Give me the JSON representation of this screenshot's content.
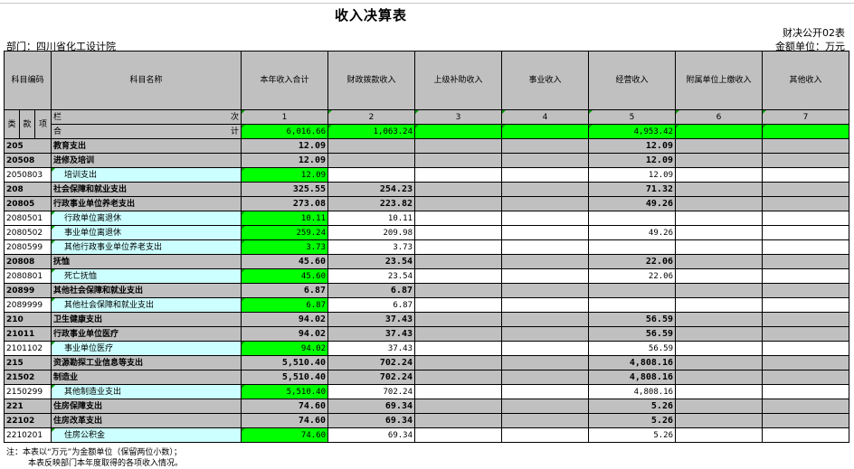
{
  "title": "收入决算表",
  "code_note": "财决公开02表",
  "unit_note": "金额单位：万元",
  "department": "部门：四川省化工设计院",
  "headers": {
    "code": "科目编码",
    "name": "科目名称",
    "cols": [
      "本年收入合计",
      "财政拨款收入",
      "上级补助收入",
      "事业收入",
      "经营收入",
      "附属单位上缴收入",
      "其他收入"
    ],
    "lei": "类",
    "kuan": "款",
    "xiang": "项",
    "lan": "栏",
    "ci": "次",
    "he": "合",
    "ji": "计",
    "colnums": [
      "1",
      "2",
      "3",
      "4",
      "5",
      "6",
      "7"
    ],
    "total": [
      "6,016.66",
      "1,063.24",
      "",
      "",
      "4,953.42",
      "",
      ""
    ]
  },
  "rows": [
    {
      "code": "205",
      "name": "教育支出",
      "vals": [
        "12.09",
        "",
        "",
        "",
        "12.09",
        "",
        ""
      ]
    },
    {
      "code": "20508",
      "name": "进修及培训",
      "vals": [
        "12.09",
        "",
        "",
        "",
        "12.09",
        "",
        ""
      ]
    },
    {
      "code": "2050803",
      "name": "培训支出",
      "vals": [
        "12.09",
        "",
        "",
        "",
        "12.09",
        "",
        ""
      ]
    },
    {
      "code": "208",
      "name": "社会保障和就业支出",
      "vals": [
        "325.55",
        "254.23",
        "",
        "",
        "71.32",
        "",
        ""
      ]
    },
    {
      "code": "20805",
      "name": "行政事业单位养老支出",
      "vals": [
        "273.08",
        "223.82",
        "",
        "",
        "49.26",
        "",
        ""
      ]
    },
    {
      "code": "2080501",
      "name": "行政单位离退休",
      "vals": [
        "10.11",
        "10.11",
        "",
        "",
        "",
        "",
        ""
      ]
    },
    {
      "code": "2080502",
      "name": "事业单位离退休",
      "vals": [
        "259.24",
        "209.98",
        "",
        "",
        "49.26",
        "",
        ""
      ]
    },
    {
      "code": "2080599",
      "name": "其他行政事业单位养老支出",
      "vals": [
        "3.73",
        "3.73",
        "",
        "",
        "",
        "",
        ""
      ]
    },
    {
      "code": "20808",
      "name": "抚恤",
      "vals": [
        "45.60",
        "23.54",
        "",
        "",
        "22.06",
        "",
        ""
      ]
    },
    {
      "code": "2080801",
      "name": "死亡抚恤",
      "vals": [
        "45.60",
        "23.54",
        "",
        "",
        "22.06",
        "",
        ""
      ]
    },
    {
      "code": "20899",
      "name": "其他社会保障和就业支出",
      "vals": [
        "6.87",
        "6.87",
        "",
        "",
        "",
        "",
        ""
      ]
    },
    {
      "code": "2089999",
      "name": "其他社会保障和就业支出",
      "vals": [
        "6.87",
        "6.87",
        "",
        "",
        "",
        "",
        ""
      ]
    },
    {
      "code": "210",
      "name": "卫生健康支出",
      "vals": [
        "94.02",
        "37.43",
        "",
        "",
        "56.59",
        "",
        ""
      ]
    },
    {
      "code": "21011",
      "name": "行政事业单位医疗",
      "vals": [
        "94.02",
        "37.43",
        "",
        "",
        "56.59",
        "",
        ""
      ]
    },
    {
      "code": "2101102",
      "name": "事业单位医疗",
      "vals": [
        "94.02",
        "37.43",
        "",
        "",
        "56.59",
        "",
        ""
      ]
    },
    {
      "code": "215",
      "name": "资源勘探工业信息等支出",
      "vals": [
        "5,510.40",
        "702.24",
        "",
        "",
        "4,808.16",
        "",
        ""
      ]
    },
    {
      "code": "21502",
      "name": "制造业",
      "vals": [
        "5,510.40",
        "702.24",
        "",
        "",
        "4,808.16",
        "",
        ""
      ]
    },
    {
      "code": "2150299",
      "name": "其他制造业支出",
      "vals": [
        "5,510.40",
        "702.24",
        "",
        "",
        "4,808.16",
        "",
        ""
      ]
    },
    {
      "code": "221",
      "name": "住房保障支出",
      "vals": [
        "74.60",
        "69.34",
        "",
        "",
        "5.26",
        "",
        ""
      ]
    },
    {
      "code": "22102",
      "name": "住房改革支出",
      "vals": [
        "74.60",
        "69.34",
        "",
        "",
        "5.26",
        "",
        ""
      ]
    },
    {
      "code": "2210201",
      "name": "住房公积金",
      "vals": [
        "74.60",
        "69.34",
        "",
        "",
        "5.26",
        "",
        ""
      ]
    }
  ],
  "footnote": [
    "注：本表以“万元”为金额单位（保留两位小数）；",
    "本表反映部门本年度取得的各项收入情况。"
  ]
}
